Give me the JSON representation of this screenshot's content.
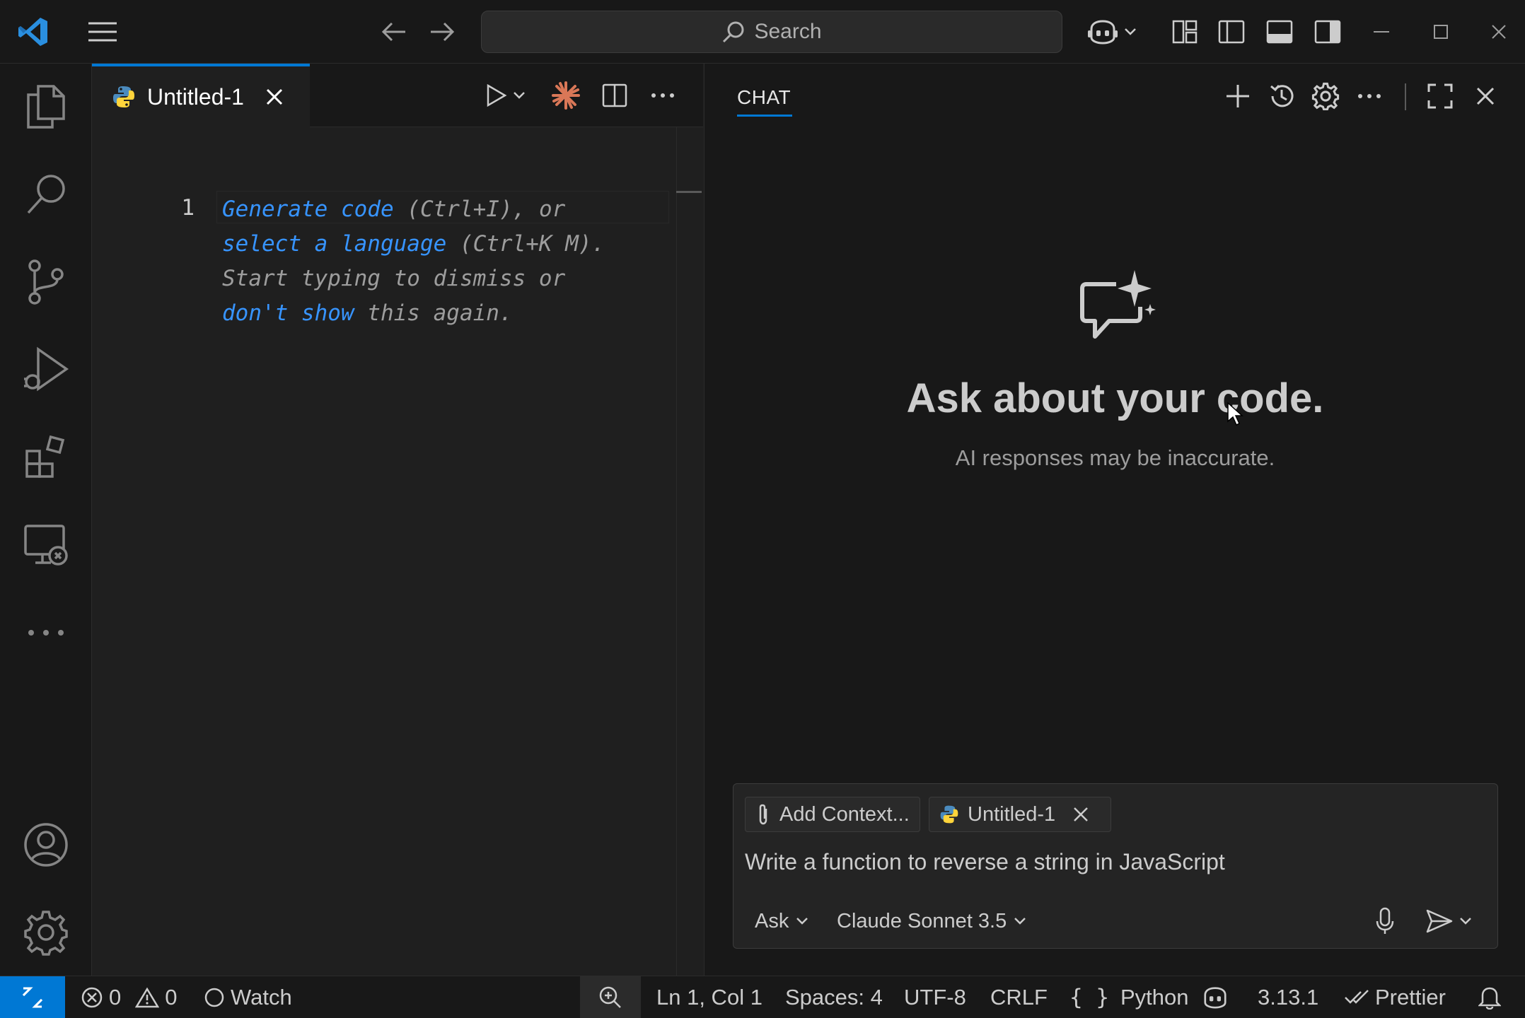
{
  "titlebar": {
    "search_placeholder": "Search",
    "icons": [
      "vscode-logo",
      "menu-icon",
      "back-arrow-icon",
      "forward-arrow-icon",
      "copilot-icon",
      "layout-customize-icon",
      "toggle-sidebar-icon",
      "toggle-panel-icon",
      "toggle-secondary-sidebar-icon",
      "minimize-icon",
      "maximize-icon",
      "close-icon"
    ]
  },
  "activitybar": {
    "items": [
      "explorer-icon",
      "search-icon",
      "source-control-icon",
      "run-debug-icon",
      "extensions-icon",
      "remote-explorer-icon",
      "more-icon",
      "accounts-icon",
      "manage-gear-icon"
    ]
  },
  "editor": {
    "tab_label": "Untitled-1",
    "line_number": "1",
    "hint": {
      "generate_code": "Generate code",
      "shortcut1": " (Ctrl+I), or",
      "select_language": "select a language",
      "shortcut2": " (Ctrl+K M).",
      "line3": "Start typing to dismiss or",
      "dont_show": "don't show",
      "line4_rest": " this again."
    }
  },
  "chat": {
    "tab_label": "CHAT",
    "heading": "Ask about your code.",
    "disclaimer": "AI responses may be inaccurate.",
    "add_context_label": "Add Context...",
    "context_file": "Untitled-1",
    "input_text": "Write a function to reverse a string in JavaScript",
    "mode": "Ask",
    "model": "Claude Sonnet 3.5"
  },
  "statusbar": {
    "errors": "0",
    "warnings": "0",
    "watch": "Watch",
    "position": "Ln 1, Col 1",
    "spaces": "Spaces: 4",
    "encoding": "UTF-8",
    "eol": "CRLF",
    "language": "Python",
    "version": "3.13.1",
    "prettier": "Prettier"
  },
  "colors": {
    "accent": "#0078d4",
    "link": "#3794ff",
    "background": "#1f1f1f",
    "chrome": "#181818"
  }
}
